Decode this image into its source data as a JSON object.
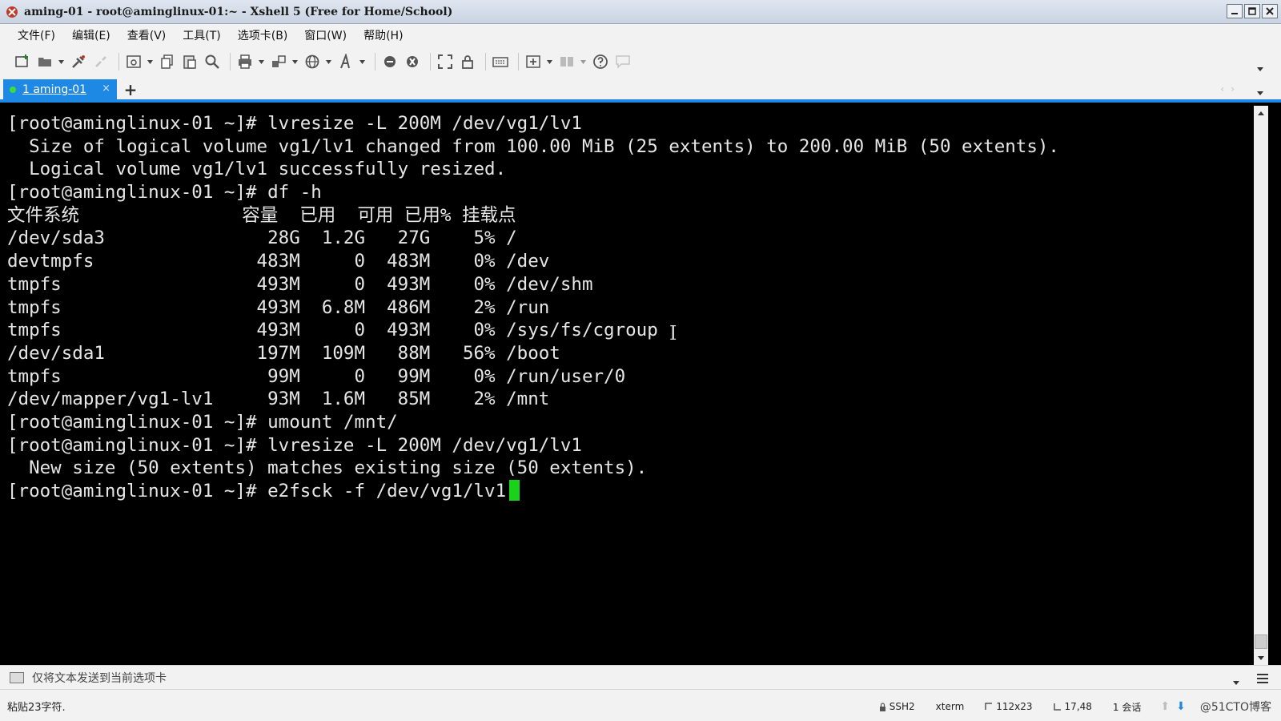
{
  "window": {
    "title": "aming-01 - root@aminglinux-01:~ - Xshell 5 (Free for Home/School)"
  },
  "menu": [
    "文件(F)",
    "编辑(E)",
    "查看(V)",
    "工具(T)",
    "选项卡(B)",
    "窗口(W)",
    "帮助(H)"
  ],
  "toolbar_icons": [
    "new-session-icon",
    "open-folder-icon",
    "reconnect-icon",
    "disconnect-icon",
    "properties-icon",
    "copy-icon",
    "paste-icon",
    "find-icon",
    "print-icon",
    "transfer-icon",
    "globe-icon",
    "font-icon",
    "xftp-icon",
    "xmanager-icon",
    "fullscreen-icon",
    "lock-icon",
    "keyboard-icon",
    "new-tab-icon",
    "layout-icon",
    "help-icon",
    "chat-icon"
  ],
  "tabs": {
    "active_label": "1 aming-01",
    "close_glyph": "×",
    "add_glyph": "+"
  },
  "terminal": {
    "lines": [
      "[root@aminglinux-01 ~]# lvresize -L 200M /dev/vg1/lv1",
      "  Size of logical volume vg1/lv1 changed from 100.00 MiB (25 extents) to 200.00 MiB (50 extents).",
      "  Logical volume vg1/lv1 successfully resized.",
      "[root@aminglinux-01 ~]# df -h",
      "文件系统               容量  已用  可用 已用% 挂载点",
      "/dev/sda3               28G  1.2G   27G    5% /",
      "devtmpfs               483M     0  483M    0% /dev",
      "tmpfs                  493M     0  493M    0% /dev/shm",
      "tmpfs                  493M  6.8M  486M    2% /run",
      "tmpfs                  493M     0  493M    0% /sys/fs/cgroup",
      "/dev/sda1              197M  109M   88M   56% /boot",
      "tmpfs                   99M     0   99M    0% /run/user/0",
      "/dev/mapper/vg1-lv1     93M  1.6M   85M    2% /mnt",
      "[root@aminglinux-01 ~]# umount /mnt/",
      "[root@aminglinux-01 ~]# lvresize -L 200M /dev/vg1/lv1",
      "  New size (50 extents) matches existing size (50 extents).",
      "[root@aminglinux-01 ~]# e2fsck -f /dev/vg1/lv1"
    ],
    "cursor_color": "#19d219"
  },
  "compose": {
    "placeholder": "仅将文本发送到当前选项卡"
  },
  "status": {
    "left": "粘贴23字符.",
    "protocol": "SSH2",
    "terminal_type": "xterm",
    "size": "112x23",
    "cursor_pos": "17,48",
    "sessions": "1 会话",
    "watermark": "@51CTO博客"
  },
  "colors": {
    "accent": "#1e88e5",
    "terminal_bg": "#000000",
    "terminal_fg": "#e6e6e6"
  }
}
